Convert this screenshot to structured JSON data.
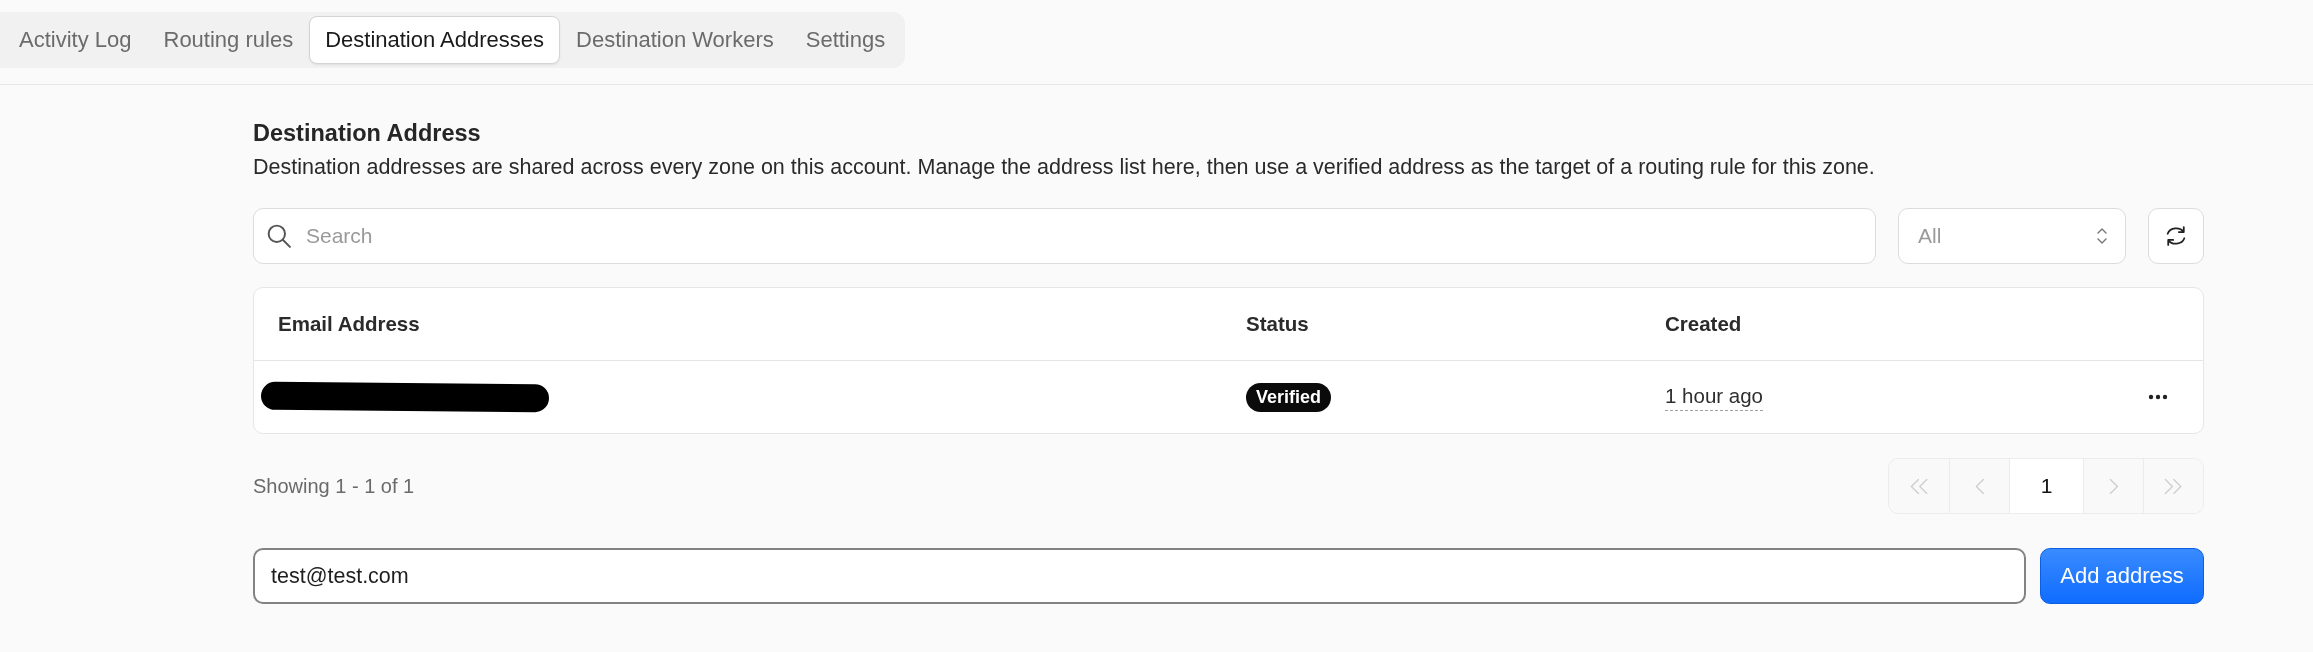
{
  "tabs": [
    {
      "label": "Activity Log",
      "selected": false
    },
    {
      "label": "Routing rules",
      "selected": false
    },
    {
      "label": "Destination Addresses",
      "selected": true
    },
    {
      "label": "Destination Workers",
      "selected": false
    },
    {
      "label": "Settings",
      "selected": false
    }
  ],
  "section": {
    "title": "Destination Address",
    "description": "Destination addresses are shared across every zone on this account. Manage the address list here, then use a verified address as the target of a routing rule for this zone."
  },
  "search": {
    "placeholder": "Search"
  },
  "status_filter": {
    "value": "All"
  },
  "table": {
    "columns": [
      "Email Address",
      "Status",
      "Created"
    ],
    "rows": [
      {
        "email_redacted": true,
        "status": "Verified",
        "created": "1 hour ago"
      }
    ]
  },
  "pagination": {
    "summary": "Showing 1 - 1 of 1",
    "first": {
      "disabled": true
    },
    "previous": {
      "disabled": true
    },
    "pages": [
      {
        "label": "1",
        "selected": true
      }
    ],
    "next": {
      "disabled": true
    },
    "last": {
      "disabled": true
    }
  },
  "add_form": {
    "value": "test@test.com",
    "button": "Add address"
  }
}
